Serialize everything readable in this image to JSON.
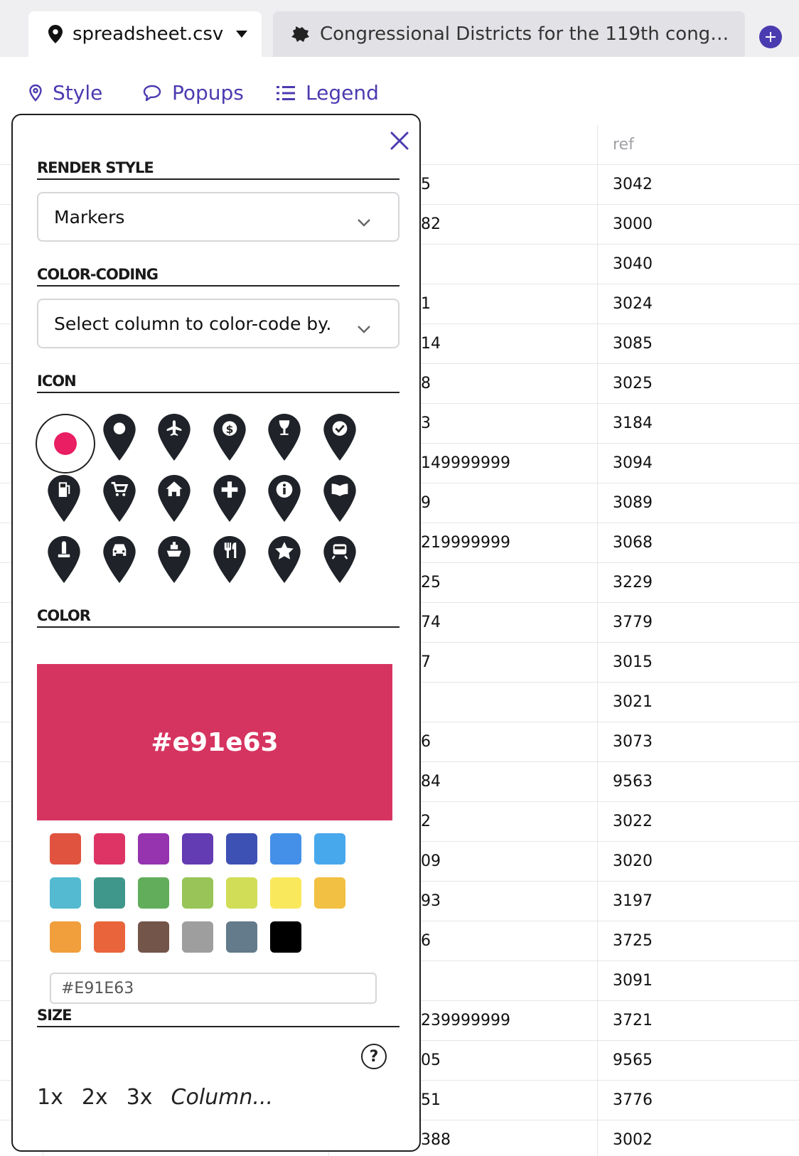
{
  "tabs": {
    "active": {
      "label": "spreadsheet.csv"
    },
    "second": {
      "label": "Congressional Districts for the 119th congr…"
    }
  },
  "toolbar": {
    "style_label": "Style",
    "popups_label": "Popups",
    "legend_label": "Legend"
  },
  "sheet": {
    "header_ref": "ref",
    "rows": [
      {
        "a": "5",
        "ref": "3042"
      },
      {
        "a": "82",
        "ref": "3000"
      },
      {
        "a": "",
        "ref": "3040"
      },
      {
        "a": "1",
        "ref": "3024"
      },
      {
        "a": "14",
        "ref": "3085"
      },
      {
        "a": "8",
        "ref": "3025"
      },
      {
        "a": "3",
        "ref": "3184"
      },
      {
        "a": "149999999",
        "ref": "3094"
      },
      {
        "a": "9",
        "ref": "3089"
      },
      {
        "a": "219999999",
        "ref": "3068"
      },
      {
        "a": "25",
        "ref": "3229"
      },
      {
        "a": "74",
        "ref": "3779"
      },
      {
        "a": "7",
        "ref": "3015"
      },
      {
        "a": "",
        "ref": "3021"
      },
      {
        "a": "6",
        "ref": "3073"
      },
      {
        "a": "84",
        "ref": "9563"
      },
      {
        "a": "2",
        "ref": "3022"
      },
      {
        "a": "09",
        "ref": "3020"
      },
      {
        "a": "93",
        "ref": "3197"
      },
      {
        "a": "6",
        "ref": "3725"
      },
      {
        "a": "",
        "ref": "3091"
      },
      {
        "a": "239999999",
        "ref": "3721"
      },
      {
        "a": "05",
        "ref": "9565"
      },
      {
        "a": "51",
        "ref": "3776"
      },
      {
        "a": "388",
        "ref": "3002"
      }
    ]
  },
  "panel": {
    "render_style_title": "RENDER STYLE",
    "render_style_value": "Markers",
    "color_coding_title": "COLOR-CODING",
    "color_coding_value": "Select column to color-code by.",
    "icon_title": "ICON",
    "icons": [
      "circle-dot",
      "map-pin",
      "airport",
      "bank",
      "bar",
      "check",
      "gas-station",
      "shopping-cart",
      "home",
      "hospital",
      "information",
      "library",
      "monument",
      "car",
      "ferry",
      "restaurant",
      "star",
      "train"
    ],
    "selected_icon": "circle-dot",
    "color_title": "COLOR",
    "color_value": "#e91e63",
    "swatches": [
      "#e0533f",
      "#dd3465",
      "#9634b0",
      "#633bb2",
      "#3d50b3",
      "#4490e8",
      "#48a8ec",
      "#53bad1",
      "#3f978b",
      "#62ad5b",
      "#98c458",
      "#d1dd56",
      "#fae85c",
      "#f2c042",
      "#f19f3c",
      "#e9643b",
      "#74554a",
      "#9e9e9e",
      "#637b8a",
      "#000000"
    ],
    "hex_value": "#E91E63",
    "size_title": "SIZE",
    "help_label": "?",
    "size_1": "1x",
    "size_2": "2x",
    "size_3": "3x",
    "size_column": "Column..."
  }
}
